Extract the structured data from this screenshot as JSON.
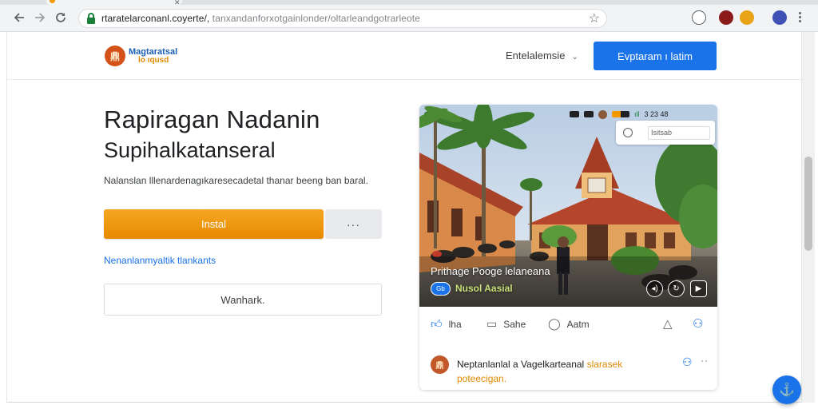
{
  "browser": {
    "url_domain": "rtaratelarconanl.coyerte/,",
    "url_path": " tanxandanforxotgainlonder/oltarleandgotrarleote",
    "tab_close_glyph": "✕"
  },
  "header": {
    "logo_mark": "鼎",
    "logo_line1": "Magtaratsal",
    "logo_line2": "lo  ıqusd",
    "language_label": "Entelalemsie",
    "cta_label": "Evptaram ı latim"
  },
  "hero": {
    "title_line1": "Rapiragan Nadanin",
    "title_line2": "Supihalkatanseral",
    "description": "Nalanslan lllenardenagıkaresecadetal thanar beeng ban baral.",
    "install_label": "Instal",
    "more_label": "···",
    "link_label": "Nenanlanmyaltik tlankants",
    "secondary_label": "Wanhark."
  },
  "card": {
    "status_time": "3 23 48",
    "search_placeholder": "Isitsab",
    "photo_caption": "Prithage Pooge lelaneana",
    "photo_badge": "Gb",
    "photo_sub": "Nusol Aasial",
    "actions": {
      "like_label": "lha",
      "share_label": "Sahe",
      "comment_label": "Aatm"
    },
    "comment": {
      "avatar": "鼎",
      "text_main": "Neptanlanlal a Vagelkarteanal ",
      "text_highlight": "slarasek",
      "text_line2": "poteecigan."
    }
  },
  "colors": {
    "primary": "#1a73e8",
    "install": "#f29900",
    "chrome": "#f1f3f4"
  },
  "icons": [
    "back-icon",
    "forward-icon",
    "reload-icon",
    "lock-icon",
    "star-icon",
    "extension-icons",
    "menu-icon",
    "like-icon",
    "share-icon",
    "comment-icon",
    "flag-icon",
    "user-icon",
    "fab-icon"
  ]
}
